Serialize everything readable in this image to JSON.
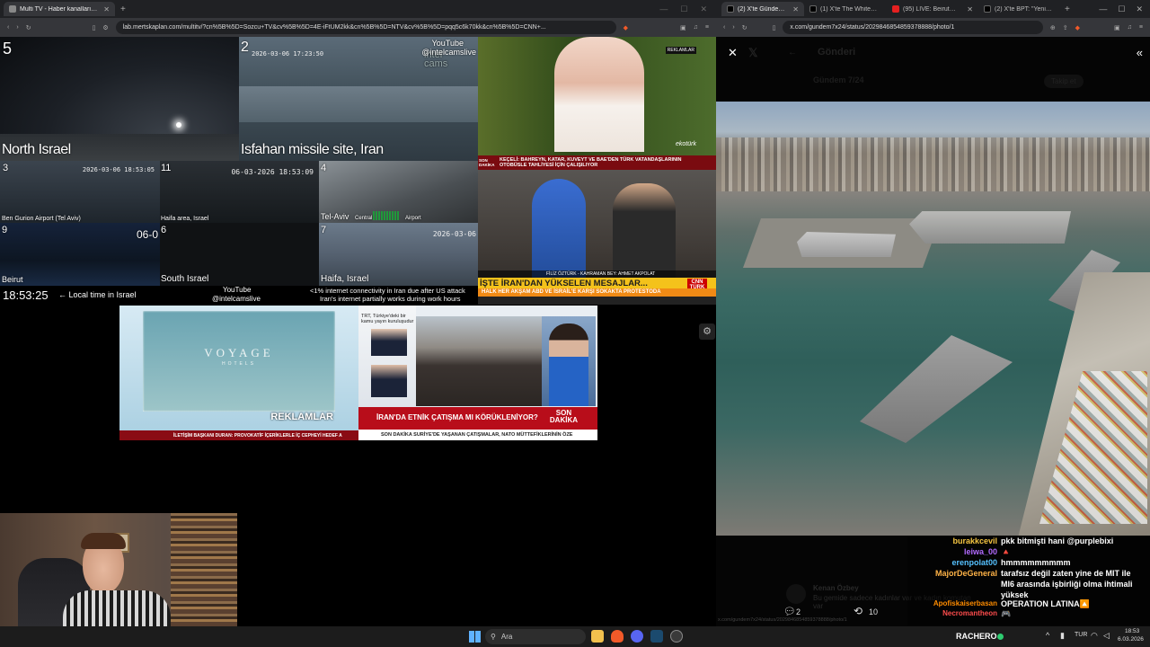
{
  "left_browser": {
    "tabs": [
      {
        "label": "Multi TV - Haber kanallarını aynı..."
      }
    ],
    "url": "lab.mertskaplan.com/multitv/?cn%5B%5D=Sozcu+TV&cv%5B%5D=4E-iFtUM2kk&cn%5B%5D=NTV&cv%5B%5D=pqq5c6k70kk&cn%5B%5D=CNN+..."
  },
  "right_browser": {
    "tabs": [
      {
        "label": "(2) X'te Gündem 7/24: ..."
      },
      {
        "label": "(1) X'te The White House: ..."
      },
      {
        "label": "(95) LIVE: Beirut skyline a..."
      },
      {
        "label": "(2) X'te BPT: \"Yeni düzenle..."
      }
    ],
    "url": "x.com/gundem7x24/status/2029846854859378888/photo/1",
    "header_title": "Gönderi",
    "author": "Gündem 7/24",
    "subscribe": "Takip et",
    "bottom_url": "x.com/gundem7x24/status/2029846854859378888/photo/1"
  },
  "cams": {
    "north_israel_num": "5",
    "north_israel_label": "North Israel",
    "isfahan_num": "2",
    "isfahan_label": "Isfahan missile site, Iran",
    "isfahan_ts": "2026-03-06  17:23:50",
    "yt_top": "YouTube",
    "yt_top_handle": "@intelcamslive",
    "intel_logo": "intel\ncams",
    "cam3_num": "3",
    "cam3_ts": "2026-03-06 18:53:05",
    "cam3_label": "Ben Gurion Airport (Tel Aviv)",
    "cam11_num": "11",
    "cam11_ts": "06-03-2026 18:53:09",
    "cam11_label": "Haifa area, Israel",
    "cam4_num": "4",
    "cam4_label": "Tel-Aviv",
    "cam4_sub": "Central",
    "cam4_sub2": "Airport",
    "cam9_num": "9",
    "cam9_ts": "06-0",
    "cam9_label": "Beirut",
    "cam6_num": "6",
    "cam6_label": "South Israel",
    "cam7_num": "7",
    "cam7_ts": "2026-03-06",
    "cam7_label": "Haifa, Israel",
    "clock": "18:53:25",
    "clock_note": "← Local time in Israel",
    "yt_bottom": "YouTube",
    "yt_bottom_handle": "@intelcamslive",
    "iran_note_1": "<1% internet connectivity in Iran due after US attack",
    "iran_note_2": "Iran's internet partially works during work hours"
  },
  "news": {
    "ekotr_reklam": "REKLAMLAR",
    "ekotr_bottom1": "SON DAKİKA",
    "ekotr_bottom2": "KEÇELİ: BAHREYN, KATAR, KUVEYT VE BAE'DEN TÜRK VATANDAŞLARININ OTOBÜSLE TAHLİYESİ İÇİN ÇALIŞILIYOR",
    "ekotr_brand": "ekotürk",
    "cnn_caption": "FİLİZ ÖZTÜRK - KAHRAMAN BEY: AHMET AKPOLAT",
    "cnn_headline": "İŞTE İRAN'DAN YÜKSELEN MESAJLAR...",
    "cnn_sub": "HALK HER AKŞAM ABD VE İSRAİL'E KARŞI SOKAKTA PROTESTODA",
    "cnn_logo": "CNN TÜRK",
    "voyage_title": "VOYAGE",
    "voyage_sub": "HOTELS",
    "voyage_reklam": "REKLAMLAR",
    "voyage_ticker": "İLETİŞİM BAŞKANI DURAN: PROVOKATİF İÇERİKLERLE İÇ CEPHEYİ HEDEF A",
    "trt_headline": "İRAN'DA ETNİK ÇATIŞMA MI KÖRÜKLENİYOR?",
    "trt_badge": "SON\nDAKİKA",
    "trt_ticker": "SON DAKİKA  SURİYE'DE YAŞANAN ÇATIŞMALAR, NATO MÜTTEFİKLERİNİN ÖZE",
    "trt_panel": "TRT, Türkiye'deki bir kamu yayın kuruluşudur"
  },
  "post": {
    "reply_count": "2",
    "repost_count": "10",
    "faded_name": "Kenan Özbey",
    "faded_text": "Bu gemide sadece kadınlar var ve kadın komutan var"
  },
  "chat": [
    {
      "user": "burakkcevil",
      "color": "#f5c542",
      "msg": "pkk bitmişti hani @purplebixi"
    },
    {
      "user": "leiwa_00",
      "color": "#b26bff",
      "msg": "🔺"
    },
    {
      "user": "erenpolat00",
      "color": "#56c1ff",
      "msg": "hmmmmmmmmm"
    },
    {
      "user": "MajorDeGeneral",
      "color": "#ffb347",
      "msg": "tarafsız değil zaten yine de MIT ile MI6 arasında işbirliği olma ihtimali yüksek"
    },
    {
      "user": "Apofiskaiserbasan",
      "color": "#ff8c00",
      "msg": "OPERATION LATINA🔼"
    },
    {
      "user": "Necromantheon",
      "color": "#ff4d4d",
      "msg": "🎮"
    }
  ],
  "streamer": {
    "name": "RACHERO"
  },
  "taskbar": {
    "search_placeholder": "Ara",
    "lang": "TUR",
    "time": "18:53",
    "date": "6.03.2026"
  }
}
